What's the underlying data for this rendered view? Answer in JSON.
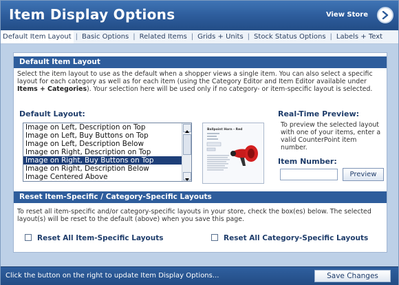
{
  "header": {
    "title": "Item Display Options",
    "view_store_label": "View Store"
  },
  "tabs": [
    {
      "label": "Default Item Layout"
    },
    {
      "label": "Basic Options"
    },
    {
      "label": "Related Items"
    },
    {
      "label": "Grids + Units"
    },
    {
      "label": "Stock Status Options"
    },
    {
      "label": "Labels + Text"
    }
  ],
  "default_layout_section": {
    "heading": "Default Item Layout",
    "description_part1": "Select the item layout to use as the default when a shopper views a single item. You can also select a specific layout for each category as well as for each item (using the Category Editor and Item Editor available under ",
    "description_bold": "Items + Categories",
    "description_part2": "). Your selection here will be used only if no category- or item-specific layout is selected.",
    "default_layout_label": "Default Layout:",
    "layout_options": [
      "Image on Left, Description on Top",
      "Image on Left, Buy Buttons on Top",
      "Image on Left, Description Below",
      "Image on Right, Description on Top",
      "Image on Right, Buy Buttons on Top",
      "Image on Right, Description Below",
      "Image Centered Above"
    ],
    "selected_option": "Image on Right, Buy Buttons on Top",
    "preview_thumbnail": {
      "lines": [
        "Ballpoint Horn - Red"
      ]
    },
    "realtime_preview_label": "Real-Time Preview:",
    "realtime_preview_text": "To preview the selected layout with one of your items, enter a valid CounterPoint item number.",
    "item_number_label": "Item Number:",
    "item_number_value": "",
    "preview_button": "Preview"
  },
  "reset_section": {
    "heading": "Reset Item-Specific / Category-Specific Layouts",
    "description": "To reset all item-specific and/or category-specific layouts in your store, check the box(es) below. The selected layout(s) will be reset to the default (above) when you save this page.",
    "reset_item_label": "Reset All Item-Specific Layouts",
    "reset_category_label": "Reset All Category-Specific Layouts",
    "reset_item_checked": false,
    "reset_category_checked": false
  },
  "footer": {
    "message": "Click the button on the right to update Item Display Options...",
    "save_button": "Save Changes"
  },
  "colors": {
    "header_blue": "#2c5b9a",
    "section_blue": "#2e5d9c",
    "selection": "#1e3f78",
    "panel_bg": "#bdd0e7",
    "horn_red": "#d42020"
  }
}
